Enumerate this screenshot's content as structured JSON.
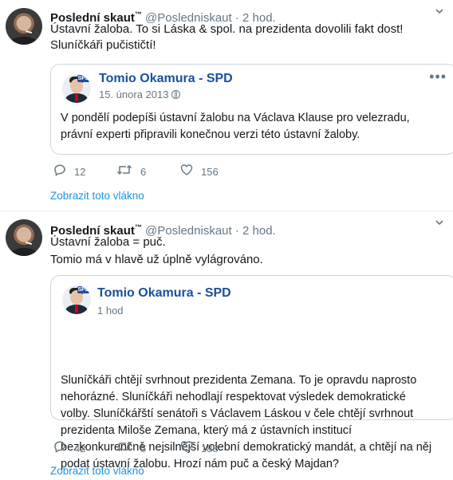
{
  "tweets": [
    {
      "author_name": "Poslední skaut",
      "author_tm": "™",
      "handle": "@Posledniskaut",
      "dot": " · ",
      "time": "2 hod.",
      "text": "Ústavní žaloba. To si Láska & spol. na prezidenta dovolili fakt dost! Sluníčkáři pučističtí!",
      "quote": {
        "name": "Tomio Okamura - SPD",
        "time": "15. února 2013",
        "text": "V pondělí podepíši ústavní žalobu na Václava Klause pro velezradu, právní experti připravili konečnou verzi této ústavní žaloby."
      },
      "replies": "12",
      "retweets": "6",
      "likes": "156",
      "thread_link": "Zobrazit toto vlákno"
    },
    {
      "author_name": "Poslední skaut",
      "author_tm": "™",
      "handle": "@Posledniskaut",
      "dot": " · ",
      "time": "2 hod.",
      "text_line1": "Ústavní žaloba = puč.",
      "text_line2": "Tomio má v hlavě už úplně vylágrováno.",
      "quote": {
        "name": "Tomio Okamura - SPD",
        "time": "1 hod",
        "text_lines": [
          "Sluníčkáři chtějí svrhnout prezidenta Zemana. To je opravdu naprosto",
          "nehorázné. Sluníčkáři nehodlají respektovat výsledek demokratické",
          "volby. Sluníčkářští senátoři s Václavem Láskou v čele chtějí svrhnout",
          "prezidenta Miloše Zemana, který má z ústavních institucí",
          "bezkonkurenčně nejsilnější volební demokratický mandát, a chtějí na něj",
          "podat ústavní žalobu. Hrozí nám puč a český Majdan?"
        ]
      },
      "replies": "42",
      "retweets": "5",
      "likes": "188",
      "thread_link": "Zobrazit toto vlákno"
    }
  ],
  "icons": {
    "reply": "reply-icon",
    "retweet": "retweet-icon",
    "like": "heart-icon",
    "menu": "chevron-down-icon",
    "more": "more-icon",
    "globe": "globe-icon"
  },
  "colors": {
    "link": "#1b95e0",
    "muted": "#657786",
    "border": "#ccd6dd",
    "spd_name": "#1b4f9c"
  }
}
